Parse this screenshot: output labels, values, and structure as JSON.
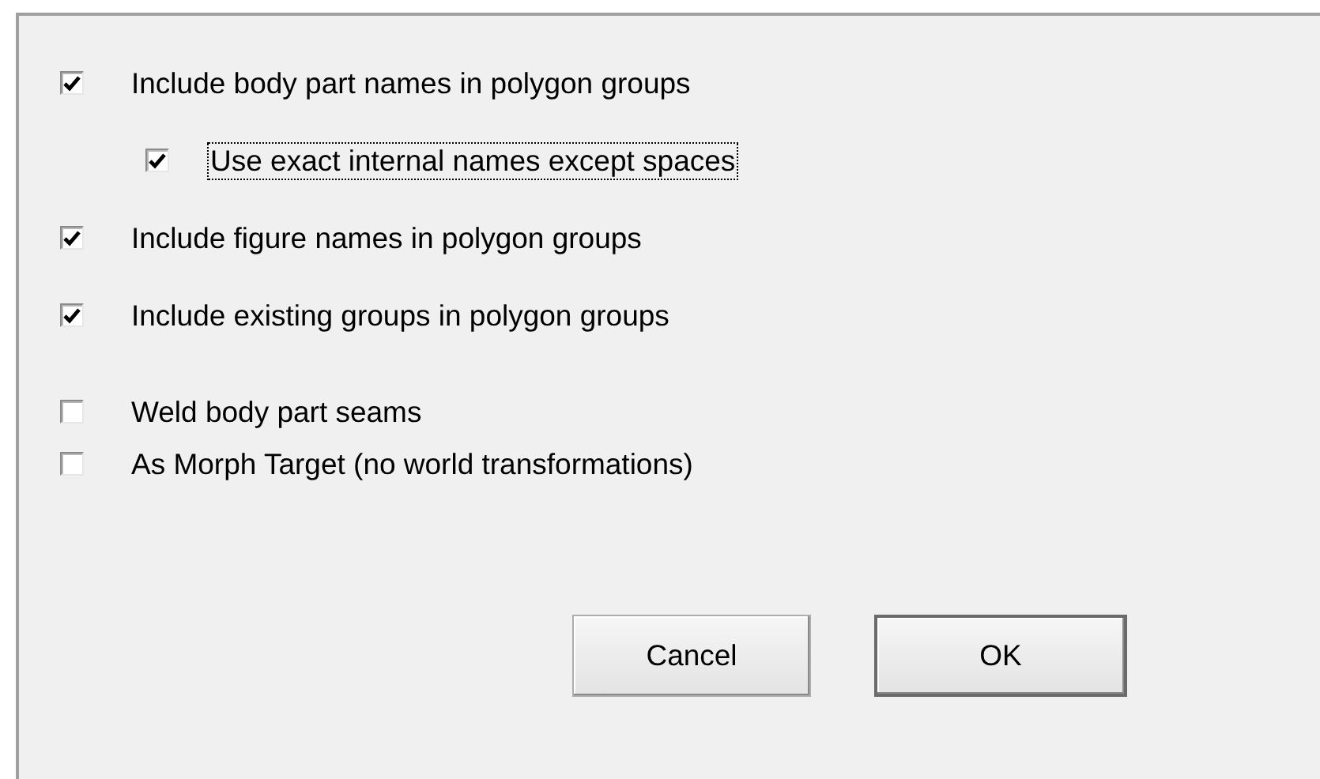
{
  "groups": [
    {
      "options": [
        {
          "label": "Include body part names in polygon groups",
          "checked": true,
          "focused": false,
          "children": [
            {
              "label": "Use exact internal names except spaces",
              "checked": true,
              "focused": true
            }
          ]
        },
        {
          "label": "Include figure names in polygon groups",
          "checked": true,
          "focused": false
        },
        {
          "label": "Include existing groups in polygon groups",
          "checked": true,
          "focused": false
        }
      ]
    },
    {
      "options": [
        {
          "label": "Weld body part seams",
          "checked": false,
          "focused": false
        },
        {
          "label": "As Morph Target (no world transformations)",
          "checked": false,
          "focused": false
        }
      ]
    }
  ],
  "buttons": [
    {
      "label": "Cancel",
      "default": false
    },
    {
      "label": "OK",
      "default": true
    }
  ]
}
